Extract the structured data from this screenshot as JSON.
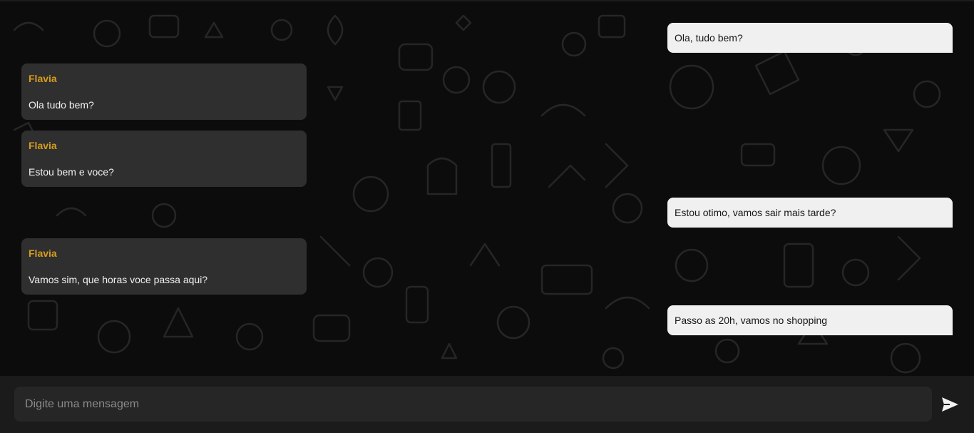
{
  "messages": [
    {
      "direction": "sent",
      "text": "Ola, tudo bem?"
    },
    {
      "direction": "received",
      "sender": "Flavia",
      "text": "Ola tudo bem?"
    },
    {
      "direction": "received",
      "sender": "Flavia",
      "text": "Estou bem e voce?"
    },
    {
      "direction": "sent",
      "text": "Estou otimo, vamos sair mais tarde?"
    },
    {
      "direction": "received",
      "sender": "Flavia",
      "text": "Vamos sim, que horas voce passa aqui?"
    },
    {
      "direction": "sent",
      "text": "Passo as 20h, vamos no shopping"
    }
  ],
  "composer": {
    "placeholder": "Digite uma mensagem",
    "value": "",
    "send_icon": "send-icon"
  },
  "colors": {
    "background": "#0c0c0c",
    "received_bubble": "#2f2f2f",
    "sent_bubble": "#f0f0f0",
    "sender_name": "#d59c1f",
    "composer_bar": "#1b1b1b",
    "input_field": "#262626"
  }
}
